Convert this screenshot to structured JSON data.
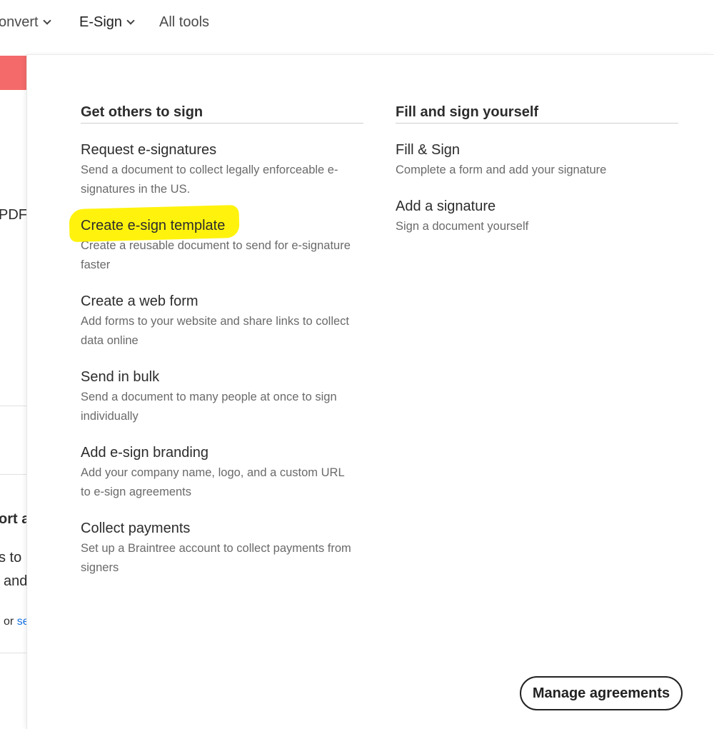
{
  "nav": {
    "convert": "onvert",
    "esign": "E-Sign",
    "alltools": "All tools"
  },
  "background": {
    "pdf": "PDF",
    "ort": "ort a",
    "s_to": "s to",
    "and": "and",
    "or": "or",
    "se": "se"
  },
  "panel": {
    "left": {
      "heading": "Get others to sign",
      "items": [
        {
          "title": "Request e-signatures",
          "desc": "Send a document to collect legally enforceable e-signatures in the US."
        },
        {
          "title": "Create e-sign template",
          "desc": "Create a reusable document to send for e-signature faster"
        },
        {
          "title": "Create a web form",
          "desc": "Add forms to your website and share links to collect data online"
        },
        {
          "title": "Send in bulk",
          "desc": "Send a document to many people at once to sign individually"
        },
        {
          "title": "Add e-sign branding",
          "desc": "Add your company name, logo, and a custom URL to e-sign agreements"
        },
        {
          "title": "Collect payments",
          "desc": "Set up a Braintree account to collect payments from signers"
        }
      ]
    },
    "right": {
      "heading": "Fill and sign yourself",
      "items": [
        {
          "title": "Fill & Sign",
          "desc": "Complete a form and add your signature"
        },
        {
          "title": "Add a signature",
          "desc": "Sign a document yourself"
        }
      ]
    },
    "manage_button": "Manage agreements"
  },
  "colors": {
    "highlight": "#fff200",
    "accent_red": "#f46a6a",
    "link": "#1473e6"
  }
}
